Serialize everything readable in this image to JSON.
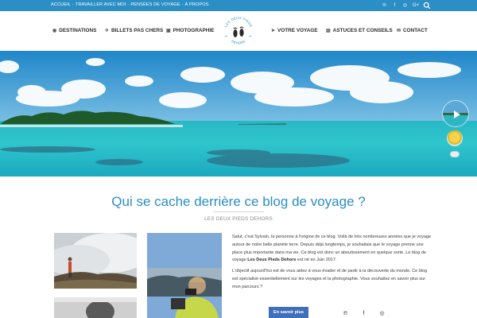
{
  "topbar": {
    "links": [
      "ACCUEIL",
      "TRAVAILLER AVEC MOI",
      "PENSÉES DE VOYAGE",
      "À PROPOS"
    ],
    "separator": "-",
    "social_icons": [
      "pinterest-icon",
      "facebook-icon",
      "instagram-icon",
      "google-plus-icon"
    ],
    "social_glyphs": [
      "℗",
      "f",
      "◎",
      "G+"
    ]
  },
  "nav": {
    "left": [
      {
        "label": "DESTINATIONS",
        "icon": "globe-icon",
        "glyph": "◉"
      },
      {
        "label": "BILLETS PAS CHERS",
        "icon": "plane-icon",
        "glyph": "✈"
      },
      {
        "label": "PHOTOGRAPHIE",
        "icon": "camera-icon",
        "glyph": "▣"
      }
    ],
    "right": [
      {
        "label": "VOTRE VOYAGE",
        "icon": "plane-icon",
        "glyph": "➤"
      },
      {
        "label": "ASTUCES ET CONSEILS",
        "icon": "lightbulb-icon",
        "glyph": "▤"
      },
      {
        "label": "CONTACT",
        "icon": "envelope-icon",
        "glyph": "✉"
      }
    ],
    "logo_text": "LES DEUX PIEDS DEHORS"
  },
  "main": {
    "headline": "Qui se cache derrière ce blog de voyage ?",
    "subhead": "LES DEUX PIEDS DEHORS",
    "para1_a": "Salut, c'est Sylvain, la personne à l'origine de ce blog. Voilà de très nombreuses années que je voyage autour de notre belle planète terre. Depuis déjà longtemps, je souhaitais que le voyage prenne une place plus importante dans ma vie. Ce blog est donc un aboutissement en quelque sorte. Le blog de voyage ",
    "para1_bold": "Les Deux Pieds Dehors",
    "para1_b": " est né en Juin 2017.",
    "para2": "L'objectif aujourd'hui est de vous aidez à vous évader et de partir à la découverte du monde. Ce blog est spécialisé essentiellement sur les voyages et la photographie. Vous souhaitez en savoir plus sur mon parcours ?",
    "button_label": "En savoir plus",
    "social_glyphs": [
      "℗",
      "f",
      "◎"
    ]
  },
  "colors": {
    "accent": "#2b8ec5",
    "button": "#3f6fb8"
  }
}
